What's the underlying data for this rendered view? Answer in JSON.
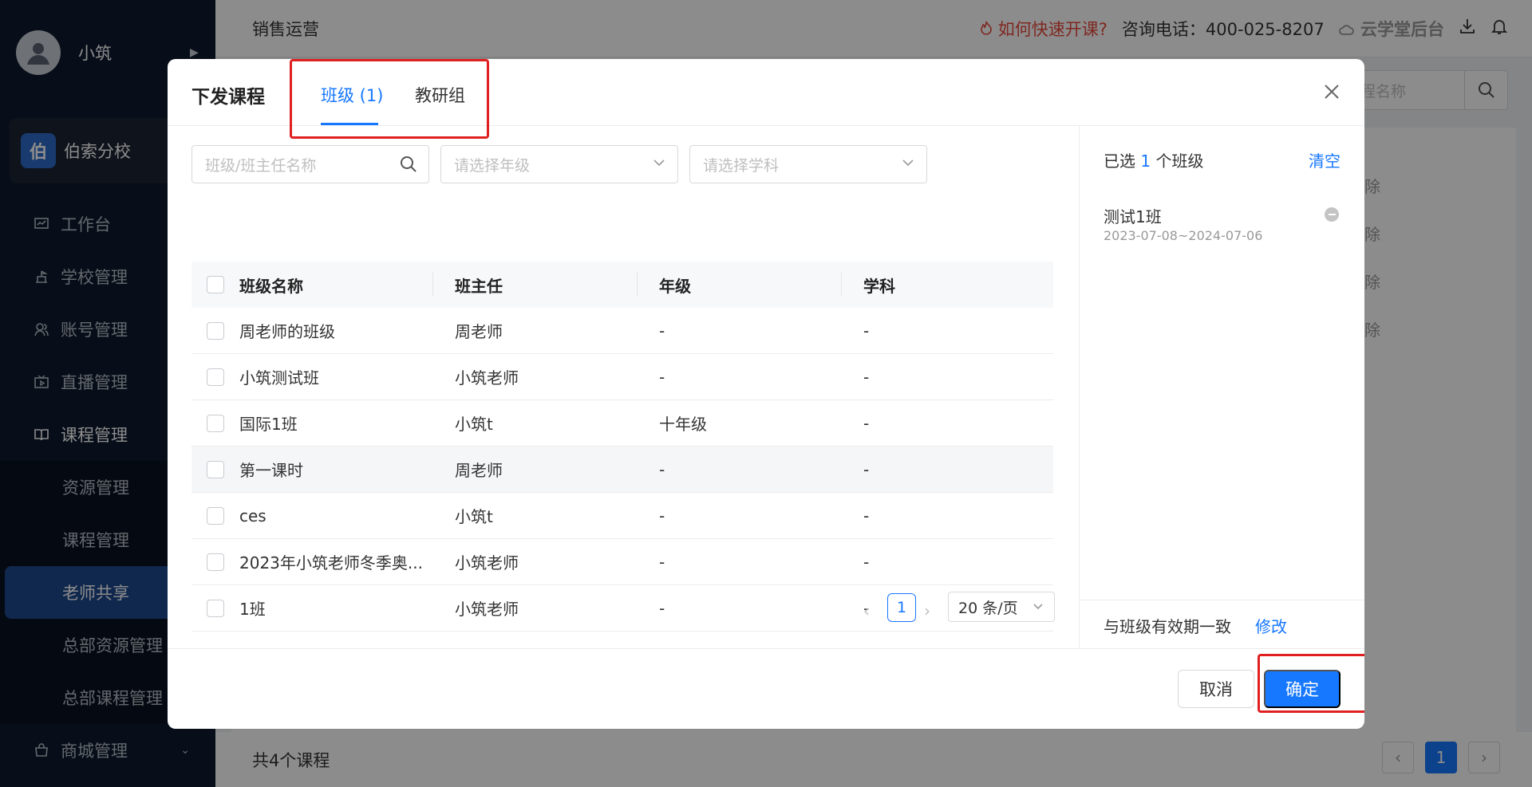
{
  "sidebar": {
    "user_name": "小筑",
    "school_logo": "伯",
    "school_name": "伯索分校",
    "items": [
      {
        "label": "工作台",
        "icon": "dashboard-icon"
      },
      {
        "label": "学校管理",
        "icon": "school-icon"
      },
      {
        "label": "账号管理",
        "icon": "users-icon"
      },
      {
        "label": "直播管理",
        "icon": "live-icon"
      },
      {
        "label": "课程管理",
        "icon": "book-icon"
      }
    ],
    "sub_items": [
      "资源管理",
      "课程管理",
      "老师共享",
      "总部资源管理",
      "总部课程管理"
    ],
    "mall": {
      "label": "商城管理",
      "icon": "shop-icon"
    }
  },
  "topbar": {
    "title": "销售运营",
    "help": "如何快速开课?",
    "phone": "咨询电话：400-025-8207",
    "brand": "云学堂后台"
  },
  "background": {
    "search_placeholder": "程名称",
    "row_fragment": "除",
    "course_count": "共4个课程",
    "page": "1"
  },
  "modal": {
    "title": "下发课程",
    "tabs": [
      {
        "label": "班级 (1)",
        "active": true
      },
      {
        "label": "教研组",
        "active": false
      }
    ],
    "filters": {
      "search_placeholder": "班级/班主任名称",
      "grade_placeholder": "请选择年级",
      "subject_placeholder": "请选择学科"
    },
    "table": {
      "columns": [
        "班级名称",
        "班主任",
        "年级",
        "学科"
      ],
      "rows": [
        {
          "name": "周老师的班级",
          "teacher": "周老师",
          "grade": "-",
          "subject": "-"
        },
        {
          "name": "小筑测试班",
          "teacher": "小筑老师",
          "grade": "-",
          "subject": "-"
        },
        {
          "name": "国际1班",
          "teacher": "小筑t",
          "grade": "十年级",
          "subject": "-"
        },
        {
          "name": "第一课时",
          "teacher": "周老师",
          "grade": "-",
          "subject": "-"
        },
        {
          "name": "ces",
          "teacher": "小筑t",
          "grade": "-",
          "subject": "-"
        },
        {
          "name": "2023年小筑老师冬季奥...",
          "teacher": "小筑老师",
          "grade": "-",
          "subject": "-"
        },
        {
          "name": "1班",
          "teacher": "小筑老师",
          "grade": "-",
          "subject": "-"
        }
      ]
    },
    "pagination": {
      "current": "1",
      "page_size": "20 条/页"
    },
    "selected": {
      "prefix": "已选",
      "count": "1",
      "suffix": "个班级",
      "clear": "清空",
      "items": [
        {
          "name": "测试1班",
          "dates": "2023-07-08~2024-07-06"
        }
      ]
    },
    "validity": {
      "text": "与班级有效期一致",
      "edit": "修改"
    },
    "buttons": {
      "cancel": "取消",
      "ok": "确定"
    },
    "colors": {
      "primary": "#1677ff",
      "highlight": "#e02020"
    }
  }
}
